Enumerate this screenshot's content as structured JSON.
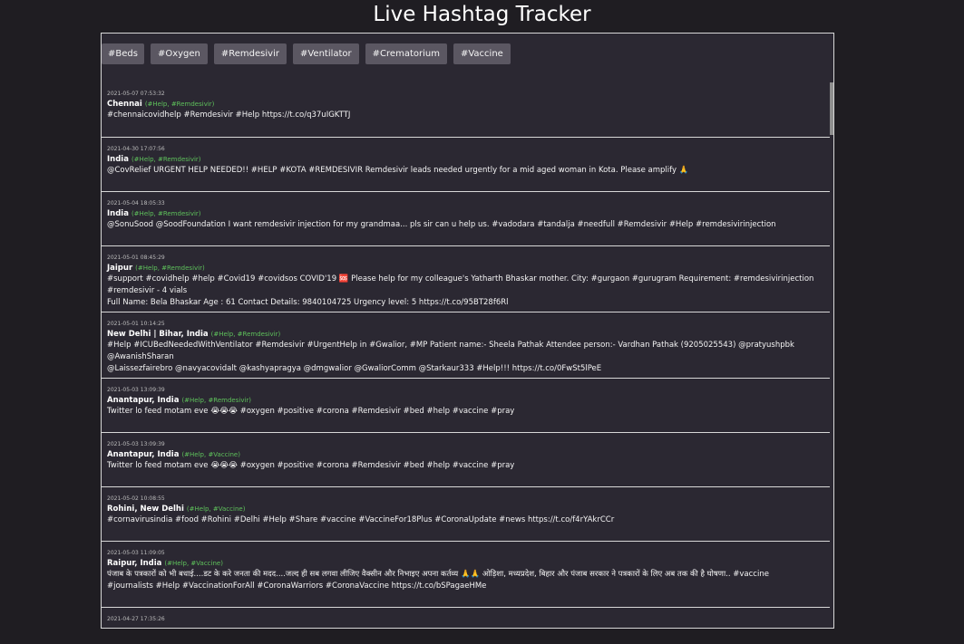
{
  "title": "Live Hashtag Tracker",
  "tabs": [
    "#Beds",
    "#Oxygen",
    "#Remdesivir",
    "#Ventilator",
    "#Crematorium",
    "#Vaccine"
  ],
  "posts": [
    {
      "time": "2021-05-07 07:53:32",
      "location": "Chennai",
      "tags": "(#Help, #Remdesivir)",
      "text": "#chennaicovidhelp #Remdesivir #Help https://t.co/q37uIGKTTJ"
    },
    {
      "time": "2021-04-30 17:07:56",
      "location": "India",
      "tags": "(#Help, #Remdesivir)",
      "text": "@CovRelief URGENT HELP NEEDED!! #HELP #KOTA #REMDESIVIR Remdesivir leads needed urgently for a mid aged woman in Kota. Please amplify 🙏"
    },
    {
      "time": "2021-05-04 18:05:33",
      "location": "India",
      "tags": "(#Help, #Remdesivir)",
      "text": "@SonuSood @SoodFoundation I want remdesivir injection for my grandmaa... pls sir can u help us. #vadodara #tandalja #needfull #Remdesivir #Help #remdesivirinjection"
    },
    {
      "time": "2021-05-01 08:45:29",
      "location": "Jaipur",
      "tags": "(#Help, #Remdesivir)",
      "text": "#support #covidhelp #help #Covid19 #covidsos COVID'19 🆘 Please help for my colleague's Yatharth Bhaskar mother. City: #gurgaon #gurugram Requirement: #remdesivirinjection #remdesivir - 4 vials\nFull Name: Bela Bhaskar Age : 61 Contact Details: 9840104725 Urgency level: 5 https://t.co/95BT28f6Rl"
    },
    {
      "time": "2021-05-01 10:14:25",
      "location": "New Delhi | Bihar, India",
      "tags": "(#Help, #Remdesivir)",
      "text": "#Help #ICUBedNeededWithVentilator #Remdesivir #UrgentHelp in #Gwalior, #MP Patient name:- Sheela Pathak Attendee person:- Vardhan Pathak (9205025543) @pratyushpbk @AwanishSharan\n@Laissezfairebro @navyacovidalt @kashyapragya @dmgwalior @GwaliorComm @Starkaur333 #Help!!! https://t.co/0FwSt5lPeE"
    },
    {
      "time": "2021-05-03 13:09:39",
      "location": "Anantapur, India",
      "tags": "(#Help, #Remdesivir)",
      "text": "Twitter lo feed motam eve 😭😭😭 #oxygen #positive #corona #Remdesivir #bed #help #vaccine #pray"
    },
    {
      "time": "2021-05-03 13:09:39",
      "location": "Anantapur, India",
      "tags": "(#Help, #Vaccine)",
      "text": "Twitter lo feed motam eve 😭😭😭 #oxygen #positive #corona #Remdesivir #bed #help #vaccine #pray"
    },
    {
      "time": "2021-05-02 10:08:55",
      "location": "Rohini, New Delhi",
      "tags": "(#Help, #Vaccine)",
      "text": "#cornavirusindia #food #Rohini #Delhi #Help #Share #vaccine #VaccineFor18Plus #CoronaUpdate #news https://t.co/f4rYAkrCCr"
    },
    {
      "time": "2021-05-03 11:09:05",
      "location": "Raipur, India",
      "tags": "(#Help, #Vaccine)",
      "text": "पंजाब के पत्रकारों को भी बधाई....डट के करे जनता की मदद....जल्द ही सब लगवा लीजिए वैक्सीन और निभाइए अपना कर्तव्य 🙏🙏 ओड़िशा, मध्यप्रदेश, बिहार और पंजाब सरकार ने पत्रकारों के लिए अब तक की है घोषणा.. #vaccine\n#journalists #Help #VaccinationForAll #CoronaWarriors #CoronaVaccine https://t.co/bSPagaeHMe"
    },
    {
      "time": "2021-04-27 17:35:26",
      "location": "",
      "tags": "",
      "text": ""
    }
  ],
  "colors": {
    "background": "#1f1d22",
    "panel": "#2b2832",
    "tab": "#5b5762",
    "tag_green": "#5ec15b"
  }
}
